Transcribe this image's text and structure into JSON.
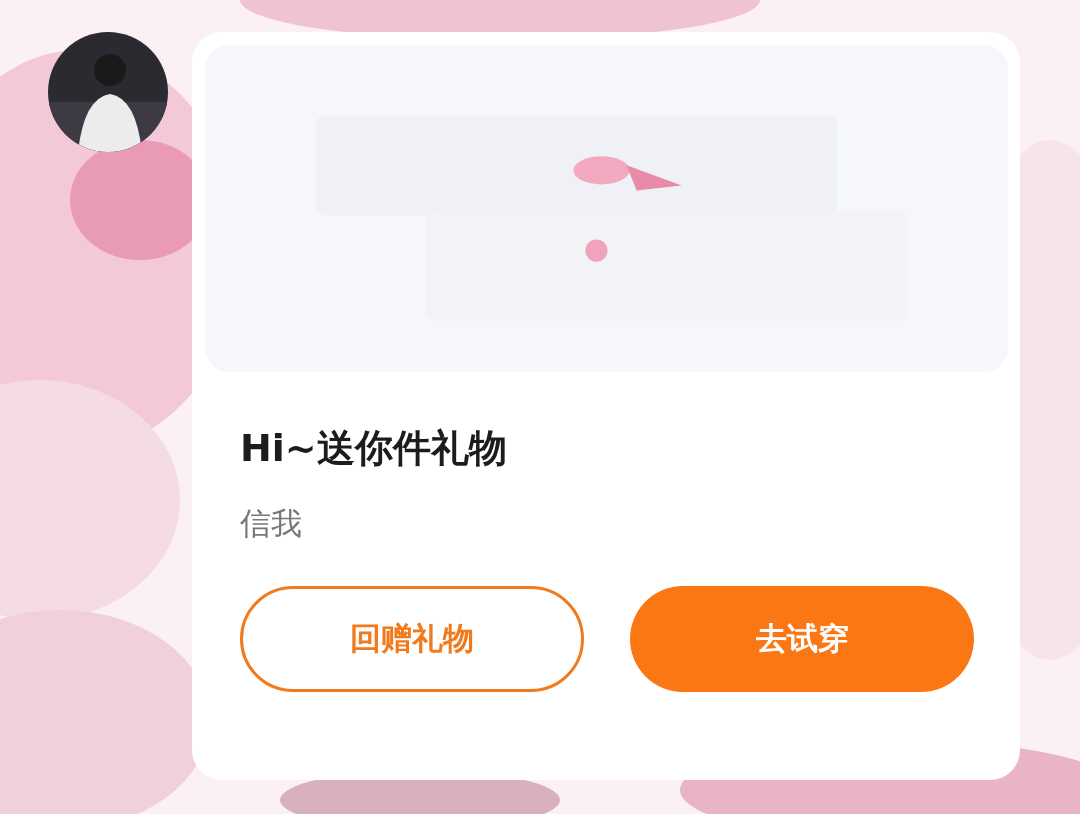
{
  "card": {
    "title": "Hi~送你件礼物",
    "message": "信我",
    "buttons": [
      {
        "label": "回赠礼物",
        "kind": "outline"
      },
      {
        "label": "去试穿",
        "kind": "primary"
      }
    ]
  }
}
